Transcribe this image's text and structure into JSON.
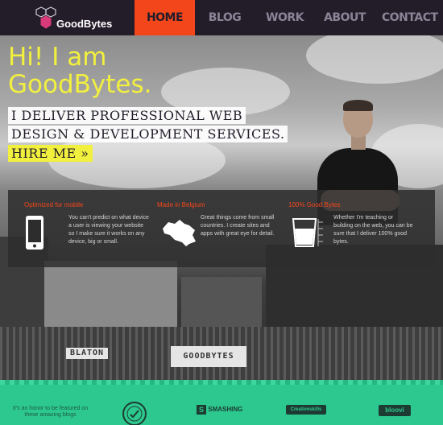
{
  "header": {
    "logo_text": "GoodBytes",
    "nav": [
      "HOME",
      "BLOG",
      "WORK",
      "ABOUT",
      "CONTACT"
    ],
    "active": "HOME"
  },
  "hero": {
    "greeting_line1": "Hi! I am",
    "greeting_line2": "GoodBytes.",
    "tagline1": "I DELIVER PROFESSIONAL WEB",
    "tagline2": "DESIGN & DEVELOPMENT SERVICES.",
    "cta": "HIRE ME »"
  },
  "background_signs": {
    "plate1": "BLATON",
    "plate2": "GOODBYTES"
  },
  "features": [
    {
      "title": "Optimized for mobile",
      "text": "You can't predict on what device a user is viewing your website so I make sure it works on any device, big or small.",
      "icon": "smartphone-icon"
    },
    {
      "title": "Made in Belgium",
      "text": "Great things come from small countries. I create sites and apps with great eye for detail.",
      "icon": "belgium-map-icon"
    },
    {
      "title": "100% Good Bytes",
      "text": "Whether I'm teaching or building on the web, you can be sure that I deliver 100% good bytes.",
      "icon": "measuring-cup-icon"
    }
  ],
  "footer": {
    "text": "It's an honor to be featured on these amazing blogs",
    "partners": [
      "SMASHING",
      "Creativeskills",
      "bloovi"
    ]
  },
  "colors": {
    "nav_bg": "#231d2a",
    "accent": "#f4461b",
    "yellow": "#f2f03e",
    "footer": "#2dc890"
  }
}
